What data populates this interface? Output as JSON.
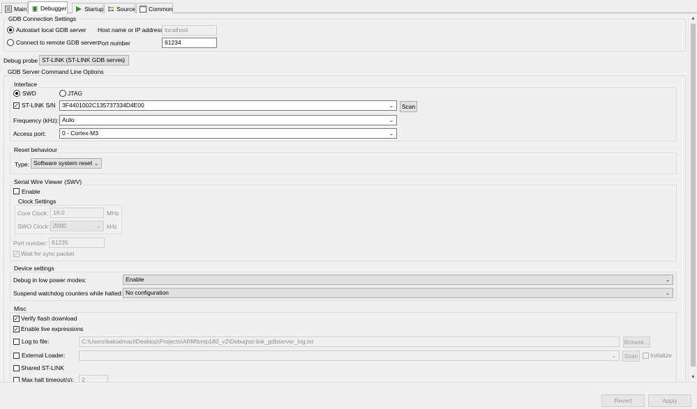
{
  "tabs": [
    {
      "label": "Main",
      "icon": "main-tab-icon"
    },
    {
      "label": "Debugger",
      "icon": "debugger-bug-icon"
    },
    {
      "label": "Startup",
      "icon": "startup-play-icon"
    },
    {
      "label": "Source",
      "icon": "source-lookup-icon"
    },
    {
      "label": "Common",
      "icon": "common-page-icon"
    }
  ],
  "gdb": {
    "title": "GDB Connection Settings",
    "autostart_label": "Autostart local GDB server",
    "remote_label": "Connect to remote GDB server",
    "host_label": "Host name or IP address",
    "host_value": "localhost",
    "port_label": "Port number",
    "port_value": "61234"
  },
  "probe": {
    "label": "Debug probe",
    "value": "ST-LINK (ST-LINK GDB server)"
  },
  "server_options": {
    "title": "GDB Server Command Line Options"
  },
  "interface": {
    "title": "Interface",
    "swd_label": "SWD",
    "jtag_label": "JTAG",
    "stlink_sn_label": "ST-LINK S/N",
    "stlink_sn_value": "3F4401002C135737334D4E00",
    "scan_label": "Scan",
    "frequency_label": "Frequency (kHz):",
    "frequency_value": "Auto",
    "access_port_label": "Access port:",
    "access_port_value": "0 - Cortex-M3"
  },
  "reset": {
    "title": "Reset behaviour",
    "type_label": "Type:",
    "type_value": "Software system reset"
  },
  "swv": {
    "title": "Serial Wire Viewer (SWV)",
    "enable_label": "Enable",
    "clock_title": "Clock Settings",
    "core_clock_label": "Core Clock:",
    "core_clock_value": "16.0",
    "core_clock_unit": "MHz",
    "swo_clock_label": "SWO Clock:",
    "swo_clock_value": "2000",
    "swo_clock_unit": "kHz",
    "port_label": "Port number:",
    "port_value": "61235",
    "wait_sync_label": "Wait for sync packet"
  },
  "device": {
    "title": "Device settings",
    "low_power_label": "Debug in low power modes:",
    "low_power_value": "Enable",
    "watchdog_label": "Suspend watchdog counters while halted:",
    "watchdog_value": "No configuration"
  },
  "misc": {
    "title": "Misc",
    "verify_flash_label": "Verify flash download",
    "live_expr_label": "Enable live expressions",
    "log_label": "Log to file:",
    "log_value": "C:\\Users\\bakialmaci\\Desktop\\Projects\\ARM\\bmp180_v2\\Debug\\st-link_gdbserver_log.txt",
    "browse_label": "Browse...",
    "ext_loader_label": "External Loader:",
    "ext_loader_value": "",
    "ext_scan_label": "Scan",
    "initialize_label": "Initialize",
    "shared_label": "Shared ST-LINK",
    "max_halt_label": "Max halt timeout(s):",
    "max_halt_value": "2"
  },
  "footer": {
    "revert_label": "Revert",
    "apply_label": "Apply"
  }
}
